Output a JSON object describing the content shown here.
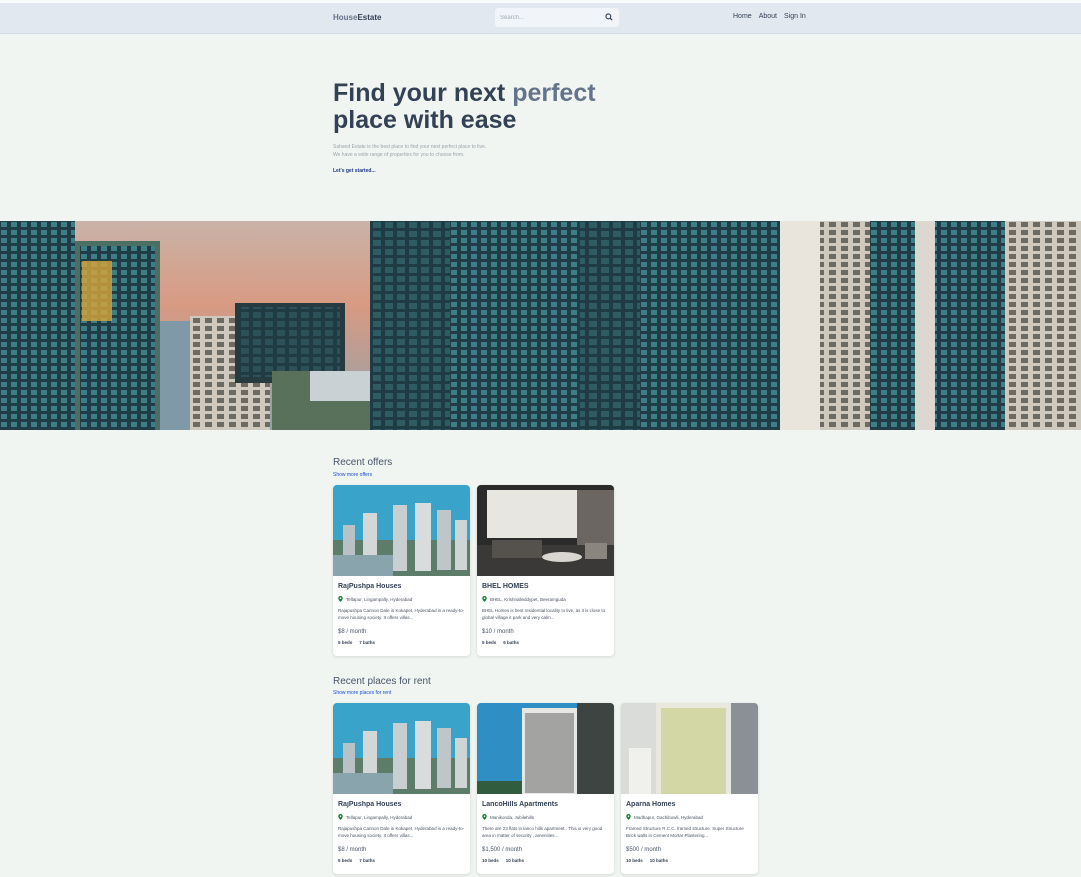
{
  "brand": {
    "part1": "House",
    "part2": "Estate"
  },
  "search": {
    "placeholder": "Search..."
  },
  "nav": {
    "home": "Home",
    "about": "About",
    "signin": "Sign In"
  },
  "hero": {
    "title_part1": "Find your next ",
    "title_accent": "perfect",
    "title_part2": "place with ease",
    "subtitle_line1": "Sahand Estate is the best place to find your next perfect place to live.",
    "subtitle_line2": "We have a wide range of properties for you to choose from.",
    "cta": "Let's get started..."
  },
  "offers": {
    "title": "Recent offers",
    "link": "Show more offers",
    "items": [
      {
        "name": "RajPushpa Houses",
        "address": "Tellapur, Lingampally, Hyderabad",
        "description": "Rajapushpa Cannon Dale in Kokapet, Hyderabad is a ready-to-move housing society. It offers villas...",
        "price": "$8 / month",
        "beds": "5 beds",
        "baths": "7 baths"
      },
      {
        "name": "BHEL HOMES",
        "address": "BHEL, Krishnalleddypet, Beeramguda",
        "description": "BHEL Homes is best residential locality to live, as it is close to global village it park and very calm...",
        "price": "$10 / month",
        "beds": "5 beds",
        "baths": "6 baths"
      }
    ]
  },
  "rent": {
    "title": "Recent places for rent",
    "link": "Show more places for rent",
    "items": [
      {
        "name": "RajPushpa Houses",
        "address": "Tellapur, Lingampally, Hyderabad",
        "description": "Rajapushpa Cannon Dale in Kokapet, Hyderabad is a ready-to-move housing society. It offers villas...",
        "price": "$8 / month",
        "beds": "5 beds",
        "baths": "7 baths"
      },
      {
        "name": "LancoHills Apartments",
        "address": "Manikonda, Jubilehills",
        "description": "There are 23 flats in lanco hills apartment . This is very good area in matter of security , amenities...",
        "price": "$1,500 / month",
        "beds": "10 beds",
        "baths": "10 baths"
      },
      {
        "name": "Aparna Homes",
        "address": "Madhapur, Gachibowli, Hyderabad",
        "description": "Framed Structure R.C.C. framed structure. Super Structure Brick walls in Cement Mortar Plastering...",
        "price": "$500 / month",
        "beds": "10 beds",
        "baths": "10 baths"
      }
    ]
  },
  "colors": {
    "header_bg": "#e2e8f0",
    "page_bg": "#f1f5f1",
    "accent": "#64748b",
    "link": "#1d4ed8",
    "pin": "#15803d"
  }
}
